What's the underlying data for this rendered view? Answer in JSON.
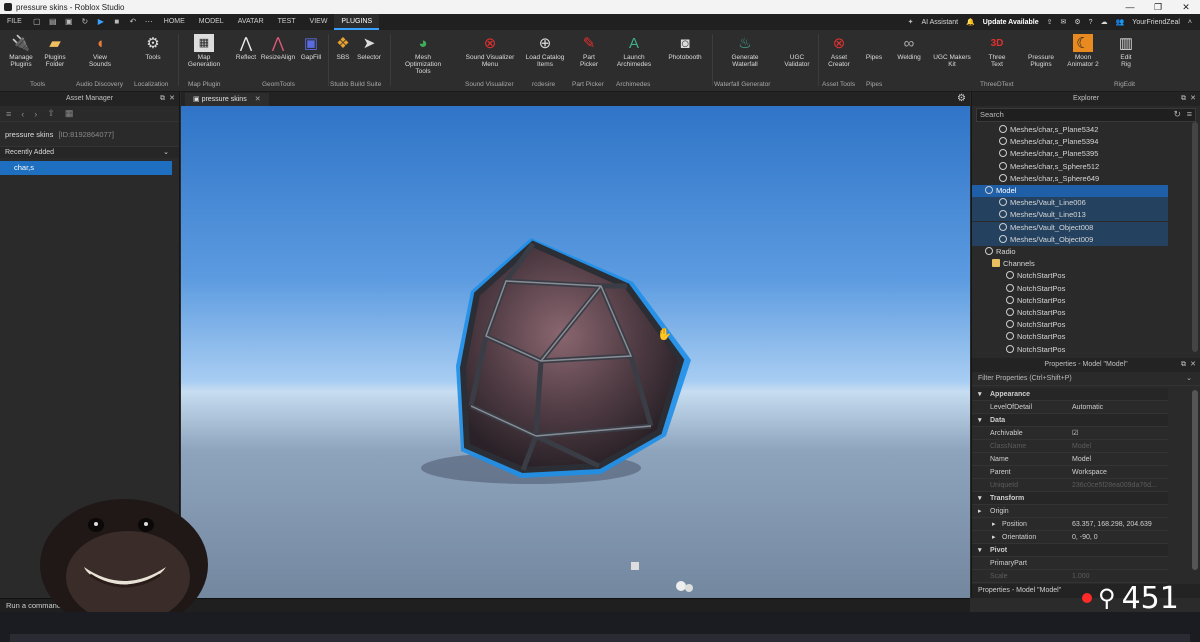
{
  "window": {
    "title": "pressure skins - Roblox Studio"
  },
  "menu": {
    "tabs": [
      "FILE",
      "HOME",
      "MODEL",
      "AVATAR",
      "TEST",
      "VIEW",
      "PLUGINS"
    ],
    "active_tab": "PLUGINS",
    "ai_assistant": "AI Assistant",
    "update": "Update Available",
    "user": "YourFriendZeal"
  },
  "ribbon": {
    "tools": [
      {
        "label": "Manage\nPlugins",
        "icon": "plug-icon"
      },
      {
        "label": "Plugins\nFolder",
        "icon": "folder-icon"
      },
      {
        "label": "View\nSounds",
        "icon": "speaker-icon"
      },
      {
        "label": "Tools",
        "icon": "wrench-icon"
      },
      {
        "label": "Map\nGeneration",
        "icon": "map-icon"
      },
      {
        "label": "Reflect",
        "icon": "reflect-icon"
      },
      {
        "label": "ResizeAlign",
        "icon": "resize-icon"
      },
      {
        "label": "GapFill",
        "icon": "gapfill-icon"
      },
      {
        "label": "SBS",
        "icon": "cube-icon"
      },
      {
        "label": "Selector",
        "icon": "cursor-icon"
      },
      {
        "label": "Mesh Optimization\nTools",
        "icon": "mesh-icon"
      },
      {
        "label": "Sound Visualizer\nMenu",
        "icon": "record-icon"
      },
      {
        "label": "Load Catalog\nItems",
        "icon": "plus-icon"
      },
      {
        "label": "Part\nPicker",
        "icon": "picker-icon"
      },
      {
        "label": "Launch\nArchimedes",
        "icon": "arch-icon"
      },
      {
        "label": "Photobooth",
        "icon": "camera-icon"
      },
      {
        "label": "Generate\nWaterfall",
        "icon": "waterfall-icon"
      },
      {
        "label": "UGC\nValidator",
        "icon": "validator-icon"
      },
      {
        "label": "Asset\nCreator",
        "icon": "asset-icon"
      },
      {
        "label": "Pipes",
        "icon": "pipes-icon"
      },
      {
        "label": "Welding",
        "icon": "weld-icon"
      },
      {
        "label": "UGC Makers\nKit",
        "icon": "kit-icon"
      },
      {
        "label": "Three\nText",
        "icon": "text3d-icon"
      },
      {
        "label": "Pressure\nPlugins",
        "icon": "pressure-icon"
      },
      {
        "label": "Moon\nAnimator 2",
        "icon": "moon-icon"
      },
      {
        "label": "Edit\nRig",
        "icon": "rig-icon"
      }
    ],
    "groups": [
      "Tools",
      "Audio Discovery",
      "Localization",
      "Map Plugin",
      "GeomTools",
      "Studio Build Suite",
      "Sound Visualizer",
      "rcdesire",
      "Part Picker",
      "Archimedes",
      "Waterfall Generator",
      "Asset Tools",
      "Pipes",
      "ThreeDText",
      "RigEdit"
    ]
  },
  "asset_manager": {
    "title": "Asset Manager",
    "place": "pressure skins",
    "place_id": "[ID:8192864077]",
    "section": "Recently Added",
    "items": [
      "char,s"
    ]
  },
  "doc_tab": "pressure skins",
  "explorer": {
    "title": "Explorer",
    "search_placeholder": "Search",
    "rows": [
      {
        "label": "Meshes/char,s_Plane5342",
        "indent": 3,
        "state": ""
      },
      {
        "label": "Meshes/char,s_Plane5394",
        "indent": 3,
        "state": ""
      },
      {
        "label": "Meshes/char,s_Plane5395",
        "indent": 3,
        "state": ""
      },
      {
        "label": "Meshes/char,s_Sphere512",
        "indent": 3,
        "state": ""
      },
      {
        "label": "Meshes/char,s_Sphere649",
        "indent": 3,
        "state": ""
      },
      {
        "label": "Model",
        "indent": 1,
        "state": "selected"
      },
      {
        "label": "Meshes/Vault_Line006",
        "indent": 3,
        "state": "soft"
      },
      {
        "label": "Meshes/Vault_Line013",
        "indent": 3,
        "state": "soft"
      },
      {
        "label": "Meshes/Vault_Object008",
        "indent": 3,
        "state": "soft"
      },
      {
        "label": "Meshes/Vault_Object009",
        "indent": 3,
        "state": "soft"
      },
      {
        "label": "Radio",
        "indent": 1,
        "state": ""
      },
      {
        "label": "Channels",
        "indent": 2,
        "state": ""
      },
      {
        "label": "NotchStartPos",
        "indent": 4,
        "state": ""
      },
      {
        "label": "NotchStartPos",
        "indent": 4,
        "state": ""
      },
      {
        "label": "NotchStartPos",
        "indent": 4,
        "state": ""
      },
      {
        "label": "NotchStartPos",
        "indent": 4,
        "state": ""
      },
      {
        "label": "NotchStartPos",
        "indent": 4,
        "state": ""
      },
      {
        "label": "NotchStartPos",
        "indent": 4,
        "state": ""
      },
      {
        "label": "NotchStartPos",
        "indent": 4,
        "state": ""
      }
    ]
  },
  "properties": {
    "title": "Properties - Model \"Model\"",
    "filter_placeholder": "Filter Properties (Ctrl+Shift+P)",
    "rows": [
      {
        "key": "Appearance",
        "value": "",
        "type": "cat"
      },
      {
        "key": "LevelOfDetail",
        "value": "Automatic",
        "type": ""
      },
      {
        "key": "Data",
        "value": "",
        "type": "cat"
      },
      {
        "key": "Archivable",
        "value": "☑",
        "type": ""
      },
      {
        "key": "ClassName",
        "value": "Model",
        "type": "dim"
      },
      {
        "key": "Name",
        "value": "Model",
        "type": ""
      },
      {
        "key": "Parent",
        "value": "Workspace",
        "type": ""
      },
      {
        "key": "UniqueId",
        "value": "236c0ce5f28ea009da76d...",
        "type": "dim"
      },
      {
        "key": "Transform",
        "value": "",
        "type": "cat"
      },
      {
        "key": "Origin",
        "value": "",
        "type": "sub"
      },
      {
        "key": "Position",
        "value": "63.357, 168.298, 204.639",
        "type": "sub2"
      },
      {
        "key": "Orientation",
        "value": "0, -90, 0",
        "type": "sub2"
      },
      {
        "key": "Pivot",
        "value": "",
        "type": "cat"
      },
      {
        "key": "PrimaryPart",
        "value": "",
        "type": ""
      },
      {
        "key": "Scale",
        "value": "1.000",
        "type": "dim"
      }
    ],
    "footer": "Properties - Model \"Model\""
  },
  "command_bar": {
    "placeholder": "Run a command"
  },
  "stream_overlay": {
    "viewers": "451"
  },
  "colors": {
    "accent": "#3aa0ff",
    "selection": "#1f5fa8"
  }
}
